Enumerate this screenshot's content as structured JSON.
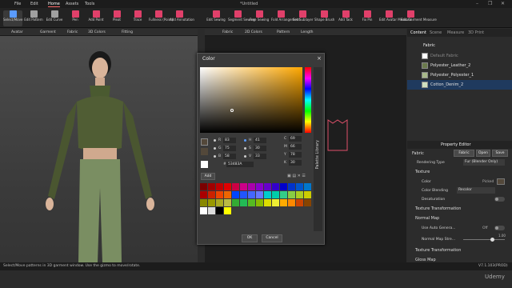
{
  "menubar": {
    "items": [
      "File",
      "Edit",
      "Home",
      "Assets",
      "Tools"
    ],
    "active": "Home",
    "title": "*Untitled",
    "window_controls": [
      "–",
      "❐",
      "✕"
    ]
  },
  "ribbon": {
    "left_tools": [
      {
        "label": "Select/Move",
        "icon": "cursor-icon",
        "color": "#5a9bff"
      },
      {
        "label": "Edit Pattern",
        "icon": "edit-pattern-icon",
        "color": "#a0a0a0"
      },
      {
        "label": "Edit Curve",
        "icon": "edit-curve-icon",
        "color": "#a0a0a0"
      },
      {
        "label": "Pen",
        "icon": "pen-icon",
        "color": "#e0406a"
      },
      {
        "label": "Add Point",
        "icon": "add-point-icon",
        "color": "#e0406a"
      },
      {
        "label": "Pleat",
        "icon": "pleat-icon",
        "color": "#e0406a"
      },
      {
        "label": "Trace",
        "icon": "trace-icon",
        "color": "#e0406a"
      },
      {
        "label": "Fullness (Point)",
        "icon": "fullness-icon",
        "color": "#e0406a"
      },
      {
        "label": "Add Annotation",
        "icon": "annotation-icon",
        "color": "#e0406a"
      }
    ],
    "right_tools": [
      {
        "label": "Edit Sewing",
        "icon": "edit-sewing-icon",
        "color": "#e0406a"
      },
      {
        "label": "Segment Sewing",
        "icon": "segment-sewing-icon",
        "color": "#e0406a"
      },
      {
        "label": "Free Sewing",
        "icon": "free-sewing-icon",
        "color": "#e0406a"
      },
      {
        "label": "Fold Arrangement",
        "icon": "fold-icon",
        "color": "#e0406a"
      },
      {
        "label": "Set Sublayer",
        "icon": "sublayer-icon",
        "color": "#e0406a"
      },
      {
        "label": "Shape Brush",
        "icon": "shape-brush-icon",
        "color": "#e0406a"
      },
      {
        "label": "Add Tack",
        "icon": "tack-icon",
        "color": "#e0406a"
      },
      {
        "label": "Fix Pin",
        "icon": "pin-icon",
        "color": "#e0406a"
      },
      {
        "label": "Edit Avatar Measure",
        "icon": "avatar-measure-icon",
        "color": "#e0406a"
      },
      {
        "label": "Edit Garment Measure",
        "icon": "garment-measure-icon",
        "color": "#e0406a"
      }
    ]
  },
  "avatar_toolbar": [
    "Avatar",
    "Garment",
    "Fabric",
    "3D Colors",
    "Fitting"
  ],
  "garment_toolbar": [
    "Fabric",
    "2D Colors",
    "Pattern",
    "Length"
  ],
  "right_panel": {
    "tabs": [
      "Content",
      "Scene",
      "Measure",
      "3D Print"
    ],
    "active_tab": "Content",
    "list_title": "Fabric",
    "fabrics": [
      {
        "name": "Default Fabric",
        "color": "#ffffff",
        "selected": false
      },
      {
        "name": "Polyester_Leather_2",
        "color": "#6b7a4d",
        "selected": false
      },
      {
        "name": "Polyester_Polyester_1",
        "color": "#a8b88a",
        "selected": false
      },
      {
        "name": "Cotton_Denim_2",
        "color": "#cfe0c0",
        "selected": true
      }
    ]
  },
  "property_editor": {
    "title": "Property Editor",
    "header_label": "Fabric",
    "header_buttons": [
      "Fabric",
      "Open",
      "Save"
    ],
    "rendering_type_label": "Rendering Type",
    "rendering_type_value": "Fur (Blender Only)",
    "texture_label": "Texture",
    "color_label": "Color",
    "color_mode": "Picked",
    "color_blending_label": "Color Blending",
    "color_blending_value": "Recolor",
    "desaturation_label": "Desaturation",
    "desaturation_value": "Off",
    "texture_transformation": "Texture Transformation",
    "normal_map": "Normal Map",
    "use_auto_gen_label": "Use Auto Genera...",
    "use_auto_gen_value": "Off",
    "normal_map_strength_label": "Normal Map Stre...",
    "normal_map_strength_value": "1.00",
    "normal_map_strength": 0.7,
    "texture_transformation_2": "Texture Transformation",
    "gloss_map": "Gloss Map"
  },
  "color_dialog": {
    "title": "Color",
    "close": "×",
    "picked_color": "#53483A",
    "fields": {
      "R": "83",
      "G": "75",
      "B": "58",
      "H": "41",
      "S": "30",
      "V": "33",
      "C": "69",
      "M": "66",
      "Y": "78",
      "K": "30",
      "hex": "53483A"
    },
    "hex_label": "#",
    "library_label": "Palette Library",
    "add_label": "Add",
    "ok_label": "OK",
    "cancel_label": "Cancel",
    "swatches": [
      "#7a0000",
      "#a00000",
      "#c00000",
      "#e00000",
      "#cc0044",
      "#cc0088",
      "#aa00aa",
      "#8800cc",
      "#6600cc",
      "#3300cc",
      "#0000cc",
      "#0033cc",
      "#0055cc",
      "#0077cc",
      "#aa0000",
      "#cc2200",
      "#ee4400",
      "#ee6600",
      "#0044ff",
      "#2255ff",
      "#4466ff",
      "#6677ff",
      "#00cccc",
      "#00ccaa",
      "#33cc88",
      "#88cc44",
      "#aacc22",
      "#cccc00",
      "#888800",
      "#999900",
      "#aaaa22",
      "#bbbb44",
      "#33aa33",
      "#22bb55",
      "#55bb22",
      "#88bb00",
      "#dddd00",
      "#eeee33",
      "#ffaa00",
      "#ff8800",
      "#cc4400",
      "#884400",
      "#ffffff",
      "#dddddd",
      "#000000",
      "#ffff00"
    ]
  },
  "statusbar": {
    "hint": "Select/Move patterns in 3D garment window. Use the gizmo to move/rotate.",
    "version": "V7.1.103(PROD)",
    "watermark": "Udemy"
  }
}
